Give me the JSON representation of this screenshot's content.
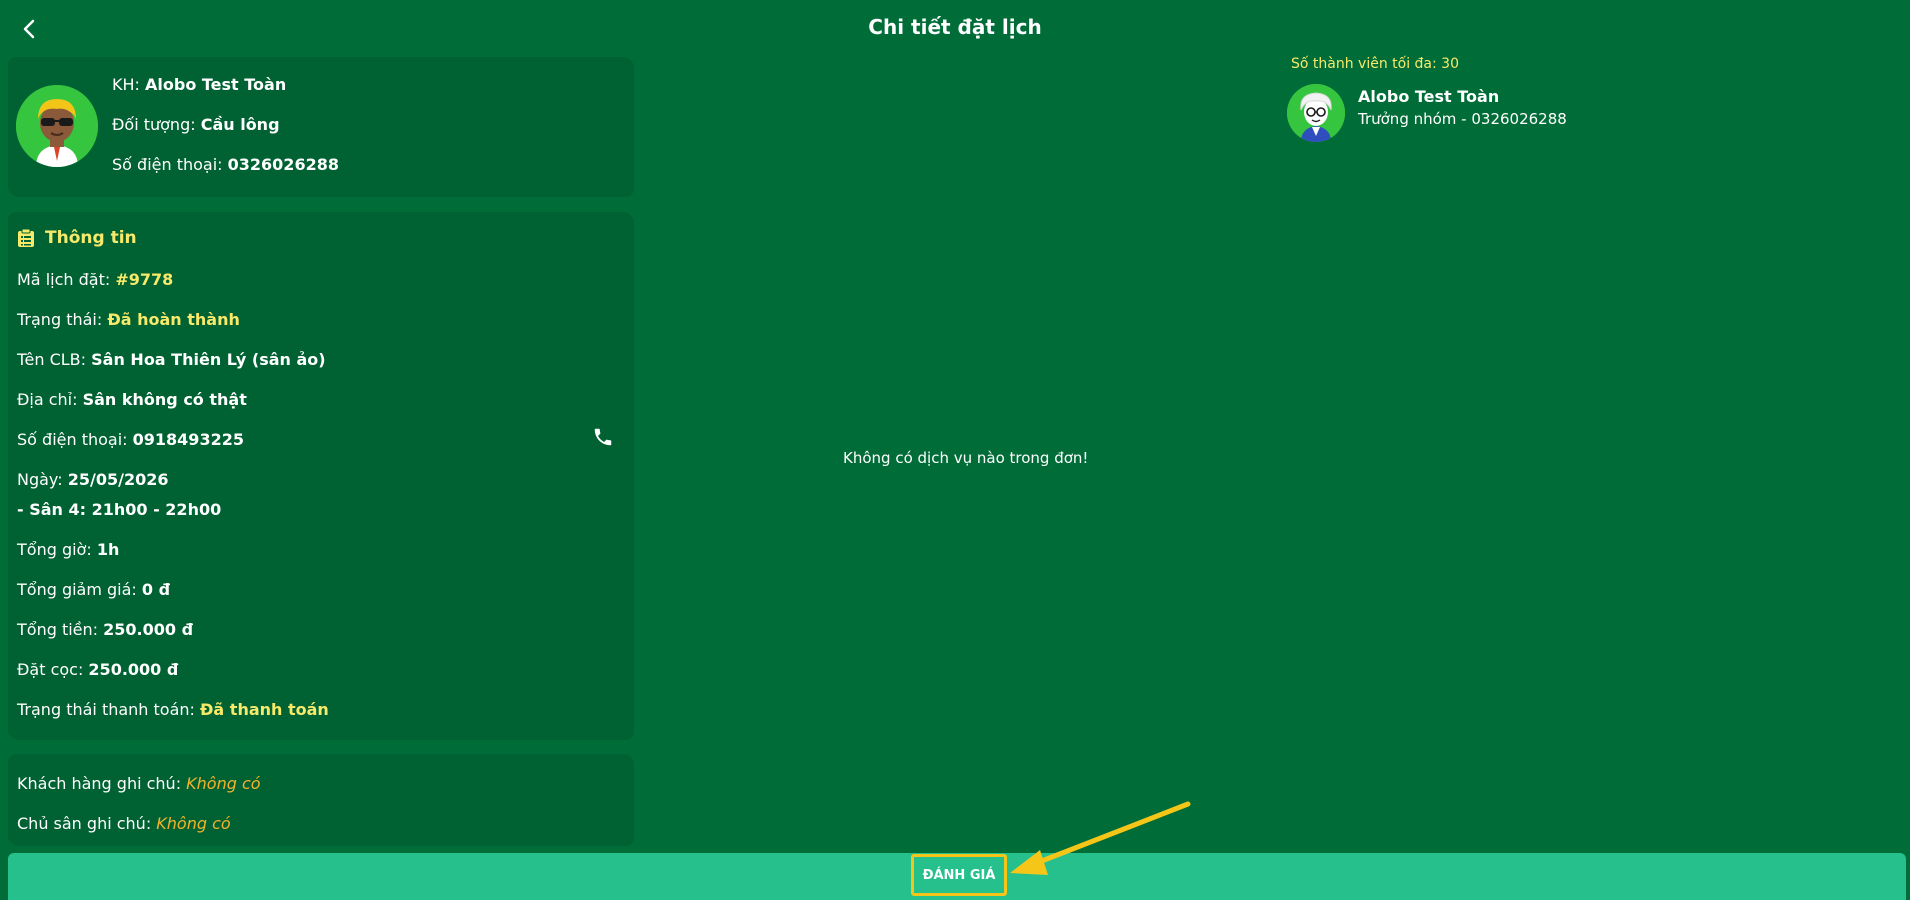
{
  "header": {
    "title": "Chi tiết đặt lịch",
    "back_icon": "chevron-left-icon"
  },
  "customer": {
    "kh_label": "KH: ",
    "kh_value": "Alobo Test Toàn",
    "object_label": "Đối tượng: ",
    "object_value": "Cầu lông",
    "phone_label": "Số điện thoại: ",
    "phone_value": "0326026288"
  },
  "info": {
    "title": "Thông tin",
    "code_label": "Mã lịch đặt: ",
    "code_value": "#9778",
    "status_label": "Trạng thái: ",
    "status_value": "Đã hoàn thành",
    "club_label": "Tên CLB: ",
    "club_value": "Sân Hoa Thiên Lý (sân ảo)",
    "address_label": "Địa chỉ: ",
    "address_value": "Sân không có thật",
    "phone_label": "Số điện thoại: ",
    "phone_value": "0918493225",
    "date_label": "Ngày: ",
    "date_value": "25/05/2026",
    "slot_value": " - Sân 4: 21h00 - 22h00",
    "hours_label": "Tổng giờ: ",
    "hours_value": "1h",
    "discount_label": "Tổng giảm giá: ",
    "discount_value": "0 đ",
    "total_label": "Tổng tiền: ",
    "total_value": "250.000 đ",
    "deposit_label": "Đặt cọc: ",
    "deposit_value": "250.000 đ",
    "payment_label": "Trạng thái thanh toán: ",
    "payment_value": "Đã thanh toán"
  },
  "notes": {
    "customer_label": "Khách hàng ghi chú: ",
    "customer_value": "Không có",
    "owner_label": "Chủ sân ghi chú: ",
    "owner_value": "Không có"
  },
  "services": {
    "empty_text": "Không có dịch vụ nào trong đơn!"
  },
  "members": {
    "max_label": "Số thành viên tối đa: 30",
    "items": [
      {
        "name": "Alobo Test Toàn",
        "role": "Trưởng nhóm - 0326026288"
      }
    ]
  },
  "footer": {
    "review_label": "ĐÁNH GIÁ"
  },
  "colors": {
    "background": "#006d38",
    "card": "#006233",
    "accent_yellow": "#f7e96a",
    "note_orange": "#f2b32b",
    "bottom_bar": "#25c08c",
    "highlight": "#f5c518"
  }
}
